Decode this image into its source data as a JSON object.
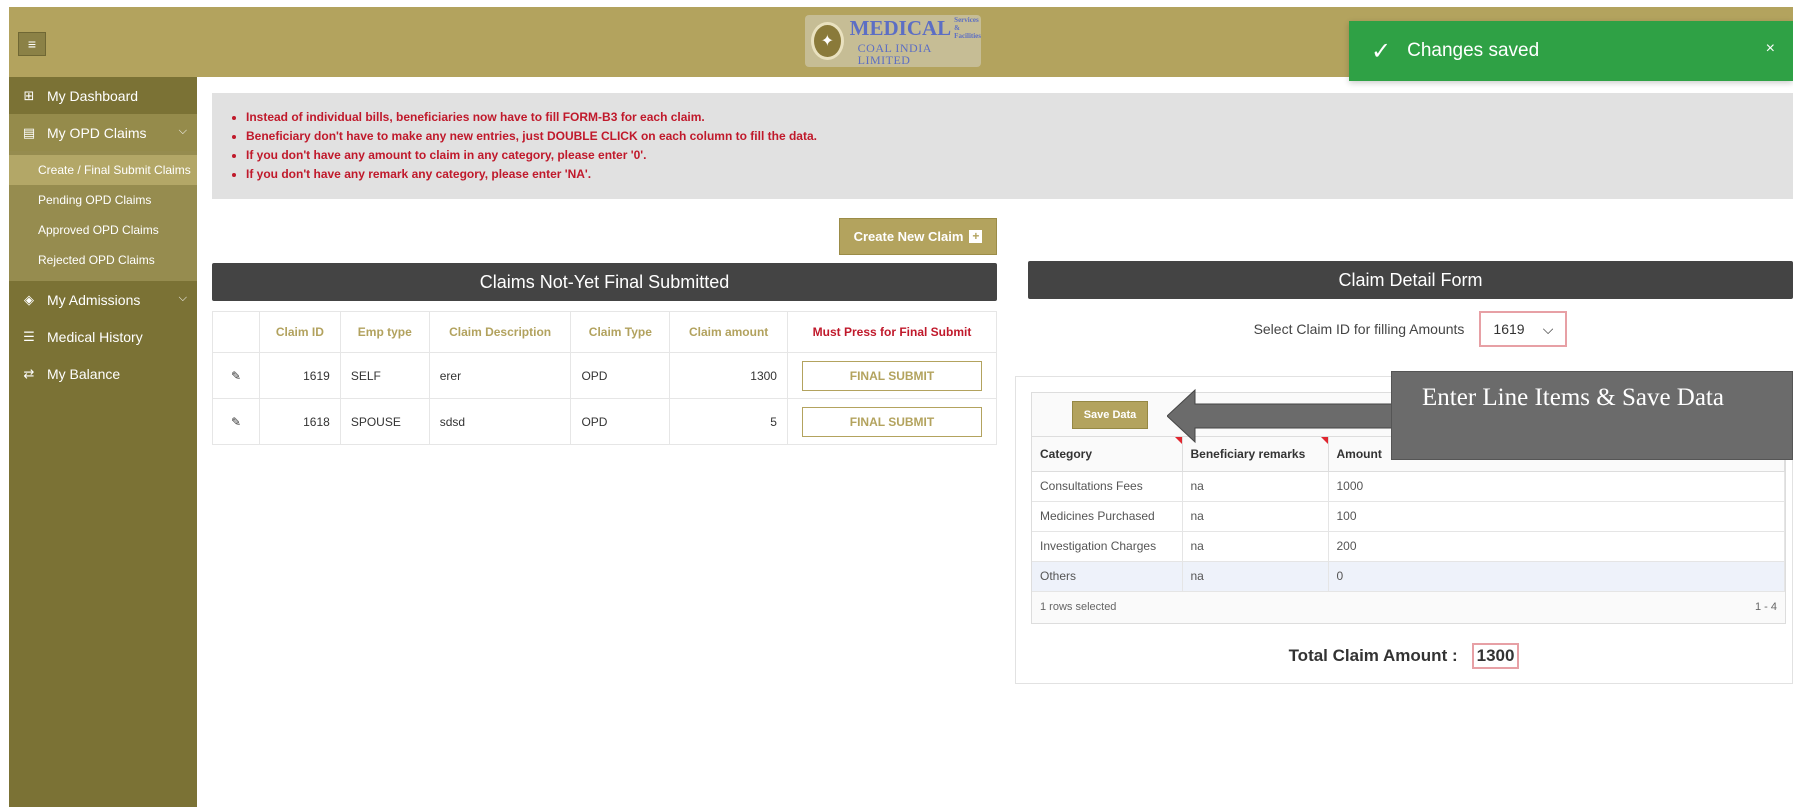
{
  "header": {
    "menu_icon": "hamburger-icon",
    "logo": {
      "brand": "MEDICAL",
      "brand_sub_1": "Services &",
      "brand_sub_2": "Facilities",
      "company": "COAL INDIA LIMITED"
    }
  },
  "toast": {
    "message": "Changes saved",
    "close": "×",
    "check": "✓",
    "color": "#2fa145"
  },
  "sidebar": {
    "items": [
      {
        "label": "My Dashboard",
        "icon": "grid-icon",
        "glyph": "⊞"
      },
      {
        "label": "My OPD Claims",
        "icon": "document-icon",
        "glyph": "▤",
        "chevron": "⌵"
      },
      {
        "label": "My Admissions",
        "icon": "layers-icon",
        "glyph": "◈",
        "chevron": "⌵"
      },
      {
        "label": "Medical History",
        "icon": "list-icon",
        "glyph": "☰"
      },
      {
        "label": "My Balance",
        "icon": "transfer-icon",
        "glyph": "⇄"
      }
    ],
    "submenu": [
      "Create / Final Submit Claims",
      "Pending OPD Claims",
      "Approved OPD Claims",
      "Rejected OPD Claims"
    ]
  },
  "notice": {
    "lines": [
      "Instead of individual bills, beneficiaries now have to fill FORM-B3 for each claim.",
      "Beneficiary don't have to make any new entries, just DOUBLE CLICK on each column to fill the data.",
      "If you don't have any amount to claim in any category, please enter '0'.",
      "If you don't have any remark any category, please enter 'NA'."
    ]
  },
  "claims": {
    "create_label": "Create New Claim",
    "title": "Claims Not-Yet Final Submitted",
    "columns": [
      "Claim ID",
      "Emp type",
      "Claim Description",
      "Claim Type",
      "Claim amount",
      "Must Press for Final Submit"
    ],
    "rows": [
      {
        "id": "1619",
        "emp": "SELF",
        "desc": "erer",
        "type": "OPD",
        "amount": "1300",
        "action": "FINAL SUBMIT"
      },
      {
        "id": "1618",
        "emp": "SPOUSE",
        "desc": "sdsd",
        "type": "OPD",
        "amount": "5",
        "action": "FINAL SUBMIT"
      }
    ]
  },
  "detail": {
    "title": "Claim Detail Form",
    "select_label": "Select Claim ID for filling Amounts",
    "selected_id": "1619",
    "save_label": "Save Data",
    "columns": [
      "Category",
      "Beneficiary remarks",
      "Amount"
    ],
    "rows": [
      {
        "category": "Consultations Fees",
        "remarks": "na",
        "amount": "1000"
      },
      {
        "category": "Medicines Purchased",
        "remarks": "na",
        "amount": "100"
      },
      {
        "category": "Investigation Charges",
        "remarks": "na",
        "amount": "200"
      },
      {
        "category": "Others",
        "remarks": "na",
        "amount": "0"
      }
    ],
    "footer_selected": "1 rows selected",
    "footer_range": "1 - 4",
    "total_label": "Total Claim Amount :",
    "total_value": "1300"
  },
  "callout": {
    "text": "Enter Line Items  & Save Data"
  },
  "colors": {
    "header": "#b3a35e",
    "sidebar": "#7b7235",
    "accent": "#b3a35e",
    "alert": "#c0192b"
  }
}
